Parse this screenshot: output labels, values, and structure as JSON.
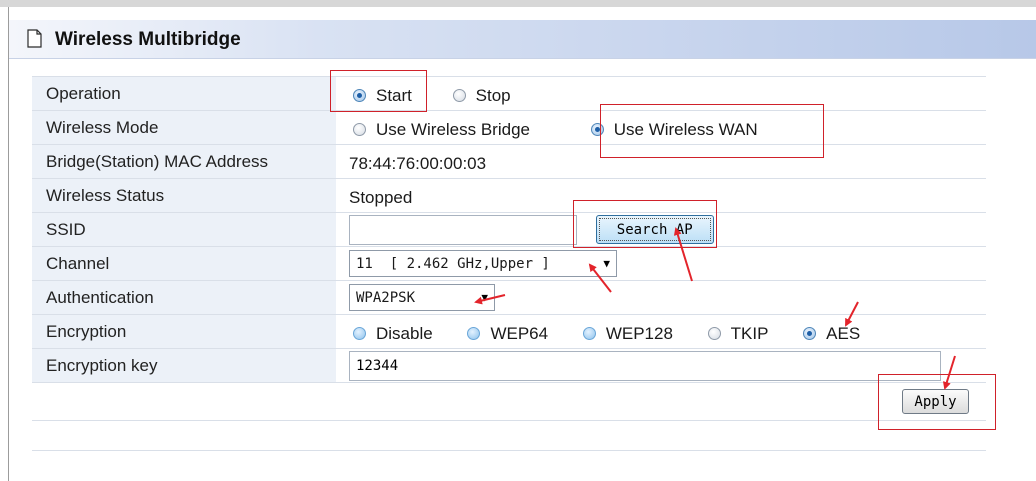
{
  "header": {
    "title": "Wireless Multibridge",
    "icon": "page-icon"
  },
  "form": {
    "operation": {
      "label": "Operation",
      "options": [
        "Start",
        "Stop"
      ],
      "selected": "Start"
    },
    "wireless_mode": {
      "label": "Wireless Mode",
      "options": [
        "Use Wireless Bridge",
        "Use Wireless WAN"
      ],
      "selected": "Use Wireless WAN"
    },
    "bridge_mac": {
      "label": "Bridge(Station) MAC Address",
      "value": "78:44:76:00:00:03"
    },
    "wireless_status": {
      "label": "Wireless Status",
      "value": "Stopped"
    },
    "ssid": {
      "label": "SSID",
      "value": "",
      "button_label": "Search AP"
    },
    "channel": {
      "label": "Channel",
      "selected": "11  [ 2.462 GHz,Upper ]"
    },
    "authentication": {
      "label": "Authentication",
      "selected": "WPA2PSK"
    },
    "encryption": {
      "label": "Encryption",
      "options": [
        "Disable",
        "WEP64",
        "WEP128",
        "TKIP",
        "AES"
      ],
      "selected": "AES"
    },
    "encryption_key": {
      "label": "Encryption key",
      "value": "12344"
    }
  },
  "apply_label": "Apply",
  "colors": {
    "header_gradient_end": "#b7c8e8",
    "label_cell": "#ecf1f8",
    "annotation_red": "#d0212a"
  }
}
